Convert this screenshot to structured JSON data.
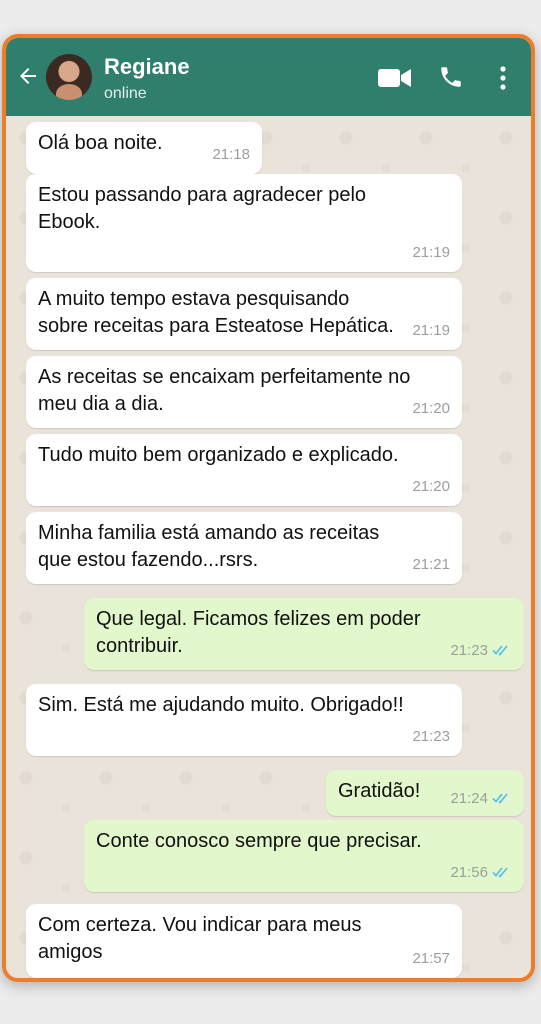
{
  "contact": {
    "name": "Regiane",
    "status": "online"
  },
  "icons": {
    "back": "arrow-left-icon",
    "video": "video-camera-icon",
    "call": "phone-icon",
    "menu": "more-vertical-icon",
    "read": "double-check-icon"
  },
  "colors": {
    "header": "#2f7f6c",
    "frame": "#ee7d2b",
    "incoming": "#ffffff",
    "outgoing": "#e2f7cb",
    "read_ticks": "#53bdeb"
  },
  "messages": [
    {
      "dir": "in",
      "text": "Olá boa noite.",
      "time": "21:18"
    },
    {
      "dir": "in",
      "text": "Estou passando para agradecer pelo\nEbook.",
      "time": "21:19"
    },
    {
      "dir": "in",
      "text": "A muito tempo  estava pesquisando\nsobre receitas para Esteatose Hepática.",
      "time": "21:19"
    },
    {
      "dir": "in",
      "text": "As receitas se encaixam perfeitamente no\nmeu dia a dia.",
      "time": "21:20"
    },
    {
      "dir": "in",
      "text": "Tudo muito bem organizado e explicado.",
      "time": "21:20"
    },
    {
      "dir": "in",
      "text": "Minha familia está amando as receitas\nque estou fazendo...rsrs.",
      "time": "21:21"
    },
    {
      "dir": "out",
      "text": "Que legal. Ficamos felizes em poder\ncontribuir.",
      "time": "21:23"
    },
    {
      "dir": "in",
      "text": "Sim. Está me ajudando muito. Obrigado!!",
      "time": "21:23"
    },
    {
      "dir": "out",
      "text": "Gratidão!",
      "time": "21:24"
    },
    {
      "dir": "out",
      "text": "Conte conosco sempre que precisar.",
      "time": "21:56"
    },
    {
      "dir": "in",
      "text": "Com certeza. Vou indicar para meus\namigos",
      "time": "21:57"
    }
  ]
}
